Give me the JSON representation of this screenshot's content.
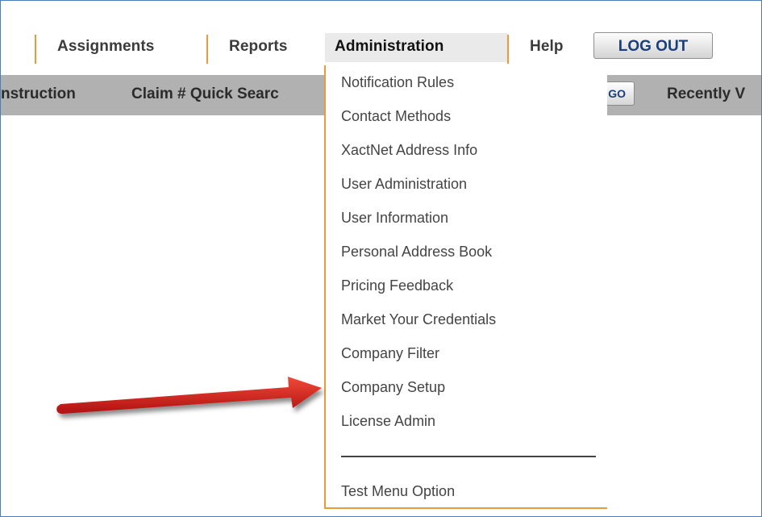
{
  "nav": {
    "items": [
      {
        "label": "Assignments"
      },
      {
        "label": "Reports"
      },
      {
        "label": "Administration"
      },
      {
        "label": "Help"
      }
    ],
    "logout_label": "LOG OUT"
  },
  "toolbar": {
    "instruction_label": "nstruction",
    "claim_search_label": "Claim # Quick Searc",
    "go_label": "GO",
    "recently_label": "Recently V"
  },
  "admin_menu": {
    "items": [
      "Notification Rules",
      "Contact Methods",
      "XactNet Address Info",
      "User Administration",
      "User Information",
      "Personal Address Book",
      "Pricing Feedback",
      "Market Your Credentials",
      "Company Filter",
      "Company Setup",
      "License Admin"
    ],
    "test_option": "Test Menu Option"
  },
  "colors": {
    "accent_orange": "#e89a3c",
    "toolbar_gray": "#b1b1b1",
    "arrow_red": "#d61a1a",
    "frame_blue": "#4a7ebb"
  },
  "icons": {
    "annotation": "red-arrow-icon"
  }
}
